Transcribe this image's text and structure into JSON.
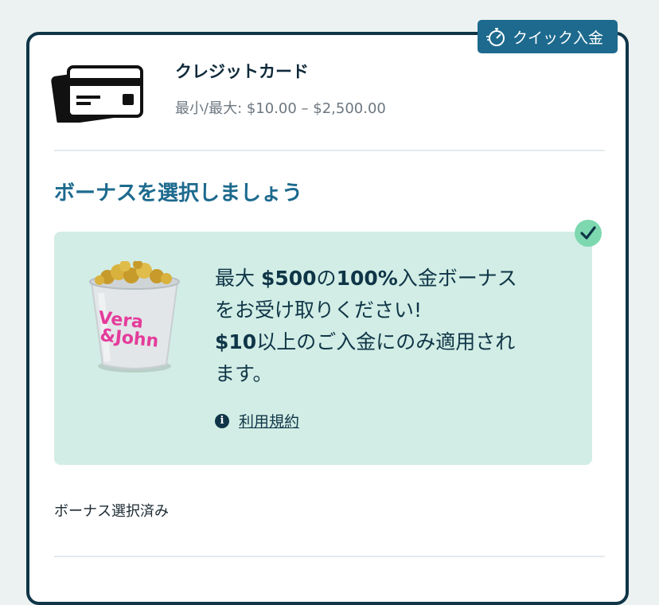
{
  "badge": {
    "label": "クイック入金",
    "icon": "stopwatch-icon"
  },
  "method": {
    "title": "クレジットカード",
    "limits": "最小/最大: $10.00 – $2,500.00",
    "icon": "credit-card-icon"
  },
  "bonus": {
    "heading": "ボーナスを選択しましょう",
    "offer": {
      "line1_pre": "最大 ",
      "line1_amount": "$500",
      "line1_mid": "の",
      "line1_pct": "100%",
      "line1_post": "入金ボーナス",
      "line2": "をお受け取りください!",
      "line3_amount": "$10",
      "line3_post": "以上のご入金にのみ適用され",
      "line4": "ます。",
      "image_text": "Vera&John",
      "selected": true
    },
    "terms_label": "利用規約",
    "selected_text": "ボーナス選択済み"
  },
  "colors": {
    "accent": "#1d6a8e",
    "navy": "#0f3547",
    "offer_bg": "#d2ede5",
    "check": "#7dd8b0"
  }
}
